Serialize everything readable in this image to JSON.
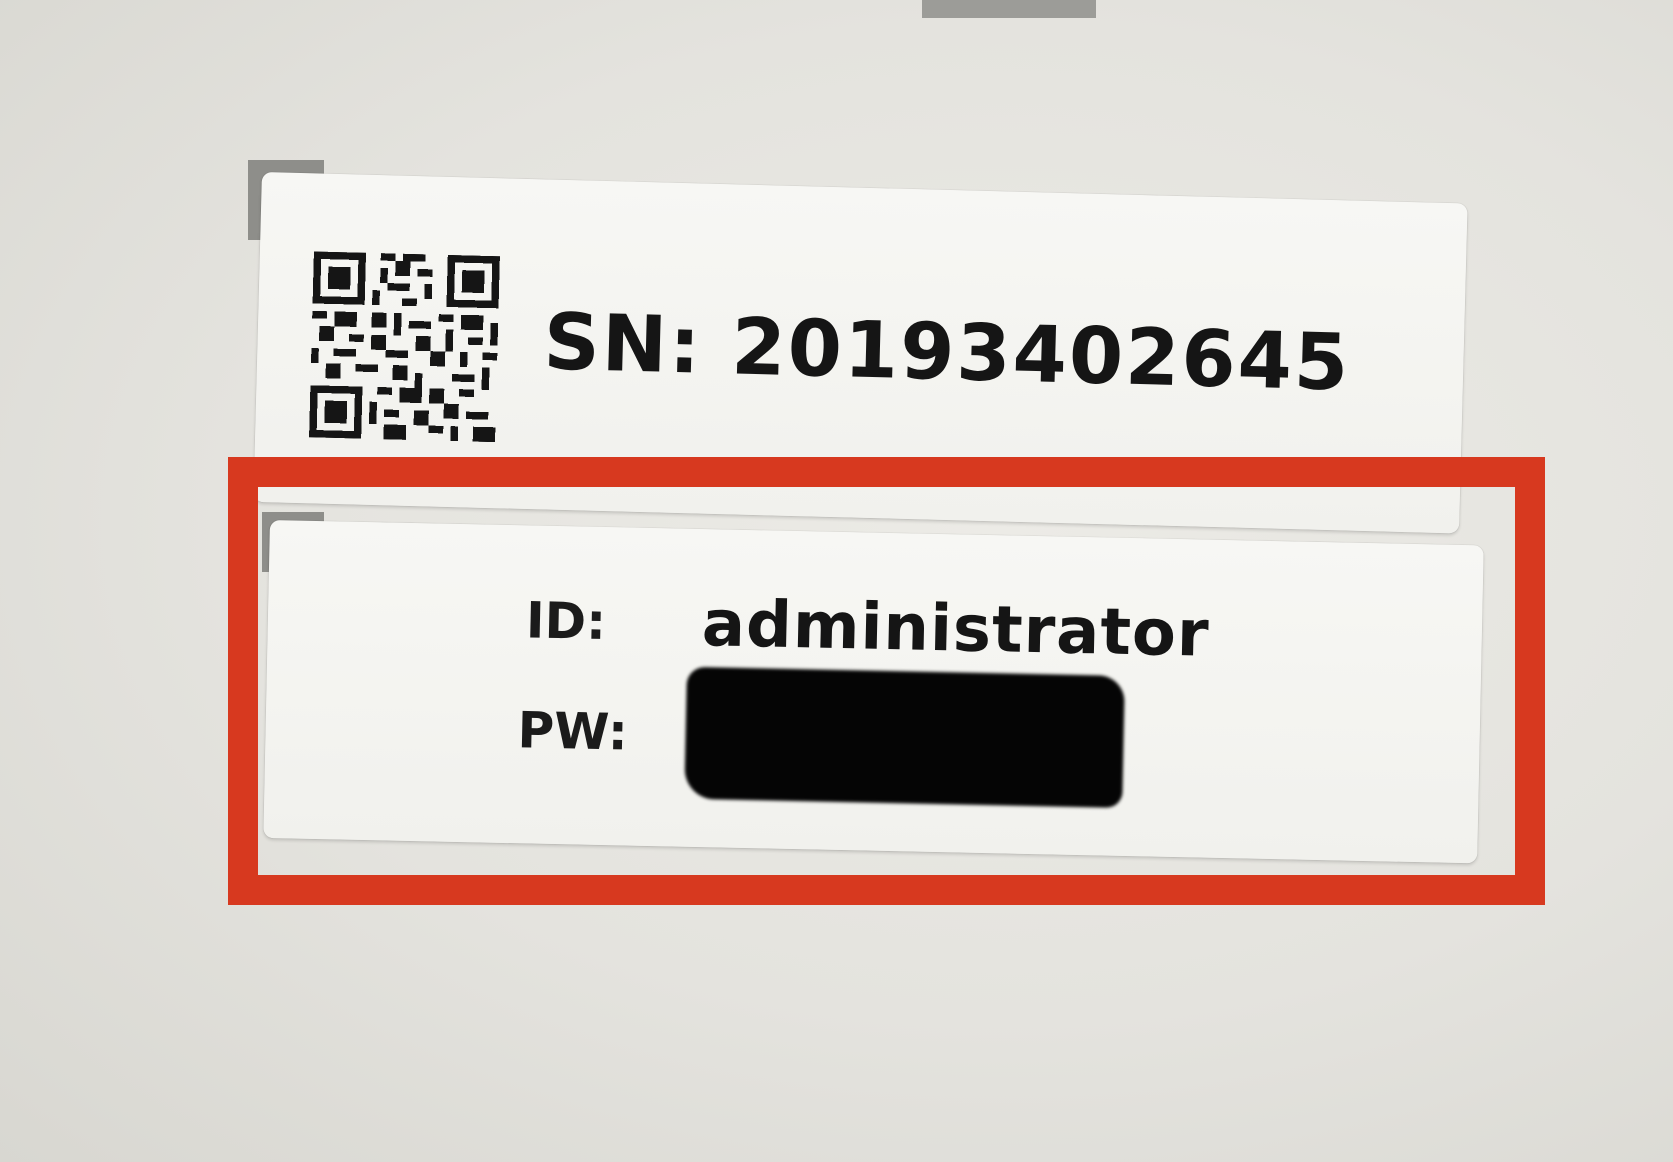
{
  "label_serial": {
    "prefix": "SN:",
    "number": "20193402645",
    "qr_code": "qr-code-icon"
  },
  "label_credentials": {
    "id_label": "ID:",
    "id_value": "administrator",
    "pw_label": "PW:",
    "pw_value": "",
    "pw_redacted": true
  },
  "highlight": {
    "color": "#d7391f"
  }
}
